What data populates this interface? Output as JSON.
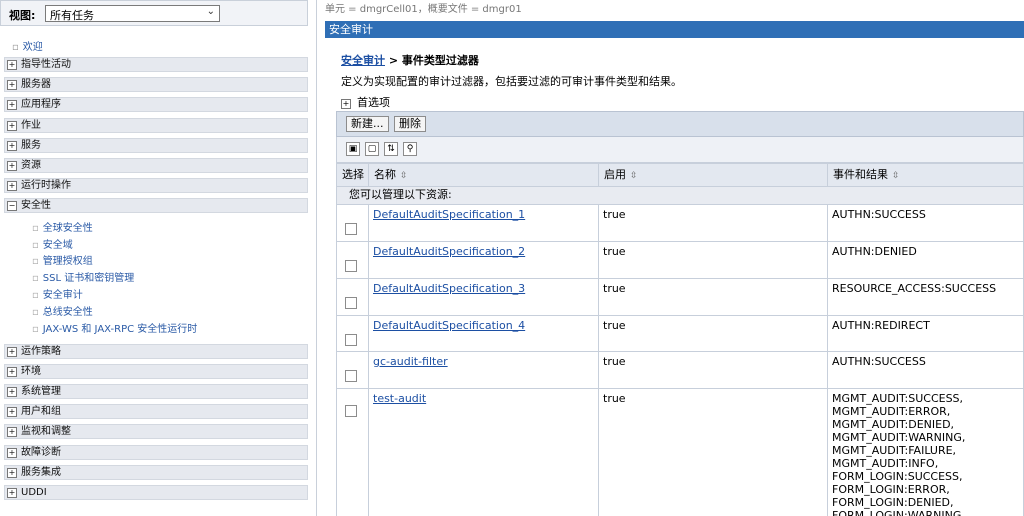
{
  "nav": {
    "view_label": "视图:",
    "view_value": "所有任务",
    "welcome": "欢迎",
    "groups": [
      {
        "label": "指导性活动",
        "sign": "+"
      },
      {
        "label": "服务器",
        "sign": "+"
      },
      {
        "label": "应用程序",
        "sign": "+"
      },
      {
        "label": "作业",
        "sign": "+"
      },
      {
        "label": "服务",
        "sign": "+"
      },
      {
        "label": "资源",
        "sign": "+"
      },
      {
        "label": "运行时操作",
        "sign": "+"
      },
      {
        "label": "安全性",
        "sign": "−"
      },
      {
        "label": "运作策略",
        "sign": "+"
      },
      {
        "label": "环境",
        "sign": "+"
      },
      {
        "label": "系统管理",
        "sign": "+"
      },
      {
        "label": "用户和组",
        "sign": "+"
      },
      {
        "label": "监视和调整",
        "sign": "+"
      },
      {
        "label": "故障诊断",
        "sign": "+"
      },
      {
        "label": "服务集成",
        "sign": "+"
      },
      {
        "label": "UDDI",
        "sign": "+"
      }
    ],
    "security_items": [
      "全球安全性",
      "安全域",
      "管理授权组",
      "SSL 证书和密钥管理",
      "安全审计",
      "总线安全性",
      "JAX-WS 和 JAX-RPC 安全性运行时"
    ]
  },
  "main": {
    "scope": "单元 = dmgrCell01，概要文件 = dmgr01",
    "title": "安全审计",
    "breadcrumb_link": "安全审计",
    "breadcrumb_sep": " > ",
    "breadcrumb_current": "事件类型过滤器",
    "description": "定义为实现配置的审计过滤器，包括要过滤的可审计事件类型和结果。",
    "preferences": "首选项",
    "buttons": {
      "new": "新建...",
      "delete": "删除"
    },
    "icons": [
      "select-all-icon",
      "deselect-all-icon",
      "show-filter-icon",
      "filter-icon"
    ],
    "table": {
      "headers": {
        "select": "选择",
        "name": "名称",
        "enabled": "启用",
        "events": "事件和结果"
      },
      "resources_caption": "您可以管理以下资源:",
      "rows": [
        {
          "name": "DefaultAuditSpecification_1",
          "enabled": "true",
          "events": "AUTHN:SUCCESS"
        },
        {
          "name": "DefaultAuditSpecification_2",
          "enabled": "true",
          "events": "AUTHN:DENIED"
        },
        {
          "name": "DefaultAuditSpecification_3",
          "enabled": "true",
          "events": "RESOURCE_ACCESS:SUCCESS"
        },
        {
          "name": "DefaultAuditSpecification_4",
          "enabled": "true",
          "events": "AUTHN:REDIRECT"
        },
        {
          "name": "gc-audit-filter",
          "enabled": "true",
          "events": "AUTHN:SUCCESS"
        },
        {
          "name": "test-audit",
          "enabled": "true",
          "events": "MGMT_AUDIT:SUCCESS,\nMGMT_AUDIT:ERROR,\nMGMT_AUDIT:DENIED,\nMGMT_AUDIT:WARNING,\nMGMT_AUDIT:FAILURE,\nMGMT_AUDIT:INFO,\nFORM_LOGIN:SUCCESS,\nFORM_LOGIN:ERROR,\nFORM_LOGIN:DENIED,\nFORM_LOGIN:WARNING"
        }
      ]
    }
  }
}
